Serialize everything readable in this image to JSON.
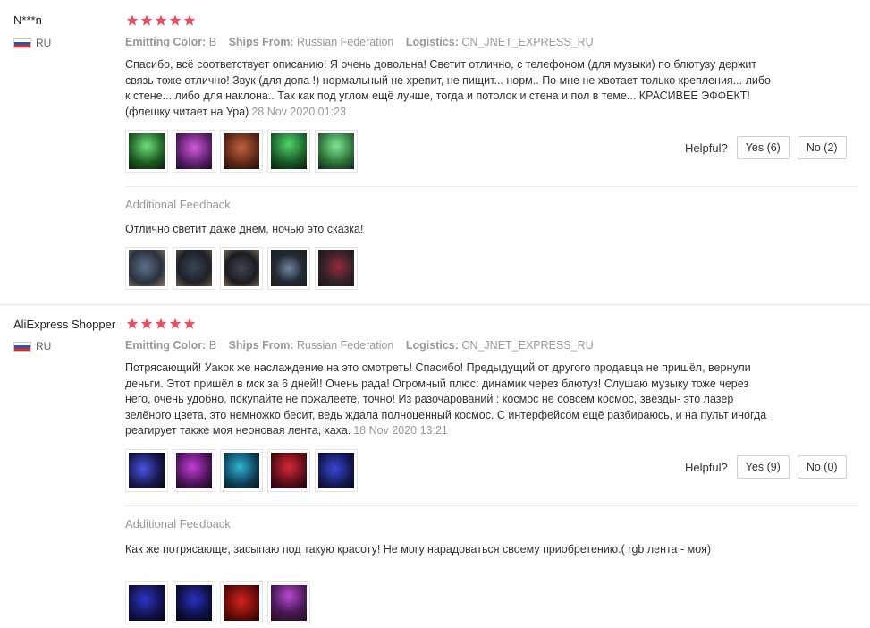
{
  "labels": {
    "emitting_color": "Emitting Color:",
    "ships_from": "Ships From:",
    "logistics": "Logistics:",
    "helpful": "Helpful?",
    "additional_feedback": "Additional Feedback"
  },
  "colors": {
    "star": "#f44b5a",
    "meta_label": "#999999"
  },
  "reviews": [
    {
      "user": "N***n",
      "country": "RU",
      "rating": 5,
      "emitting_color": "B",
      "ships_from": "Russian Federation",
      "logistics": "CN_JNET_EXPRESS_RU",
      "text": "Спасибо, всё соответствует описанию! Я очень довольна! Светит отлично, с телефоном (для музыки) по блютузу держит связь тоже отлично! Звук (для допа !) нормальный не хрепит, не пищит... норм.. По мне не хвотает только крепления... либо к стене... либо для наклона.. Так как под углом ещё лучше, тогда и потолок и стена и пол в теме... КРАСИВЕЕ ЭФФЕКТ! (флешку читает на Ура)",
      "date": "28 Nov 2020 01:23",
      "yes": "Yes (6)",
      "no": "No (2)",
      "additional_text": "Отлично светит даже днем, ночью это сказка!"
    },
    {
      "user": "AliExpress Shopper",
      "country": "RU",
      "rating": 5,
      "emitting_color": "B",
      "ships_from": "Russian Federation",
      "logistics": "CN_JNET_EXPRESS_RU",
      "text": "Потрясающий! Уакок же наслаждение на это смотреть! Спасибо! Предыдущий от другого продавца не пришёл, вернули деньги. Этот пришёл в мск за 6 дней!! Очень рада! Огромный плюс: динамик через блютуз! Слушаю музыку тоже через него, очень удобно, покупайте не пожалеете, точно! Из разочарований : космос не совсем космос, звёзды- это лазер зелёного цвета, это немножко бесит, ведь ждала полноценный космос. С интерфейсом ещё разбираюсь, и на пульт иногда реагирует также моя неоновая лента, хаха.",
      "date": "18 Nov 2020 13:21",
      "yes": "Yes (9)",
      "no": "No (0)",
      "additional_text": "Как же потрясающе, засыпаю под такую красоту! Не могу нарадоваться своему приобретению.( rgb лента - моя)"
    }
  ]
}
